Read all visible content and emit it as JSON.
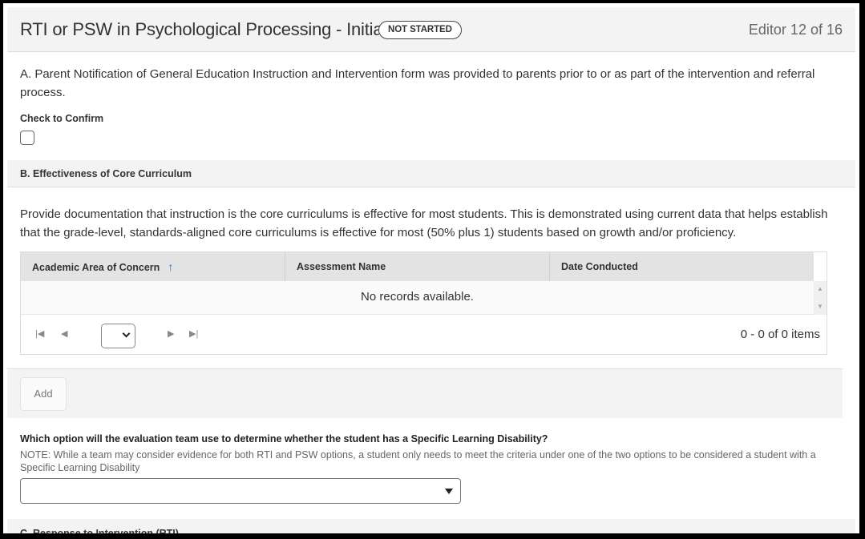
{
  "editor": {
    "title": "RTI or PSW in Psychological Processing - Initial",
    "status": "NOT STARTED",
    "counter": "Editor 12 of 16"
  },
  "section_a": {
    "text": "A. Parent Notification of General Education Instruction and Intervention form was provided to parents prior to or as part of the intervention and referral process.",
    "checkbox_label": "Check to Confirm",
    "checked": false
  },
  "section_b": {
    "title": "B. Effectiveness of Core Curriculum",
    "text": "Provide documentation that instruction is the core curriculums is effective for most students. This is demonstrated using current data that helps establish that the grade-level, standards-aligned core curriculums is effective for most (50% plus 1) students based on growth and/or proficiency.",
    "grid": {
      "columns": [
        {
          "label": "Academic Area of Concern",
          "sort": "ascending",
          "sort_icon": "arrow-up-icon"
        },
        {
          "label": "Assessment Name"
        },
        {
          "label": "Date Conducted"
        }
      ],
      "rows": [],
      "empty_message": "No records available.",
      "pager": {
        "first_icon": "first-page-icon",
        "prev_icon": "prev-page-icon",
        "next_icon": "next-page-icon",
        "last_icon": "last-page-icon",
        "page_size_value": "",
        "info": "0 - 0 of 0 items"
      }
    },
    "add_label": "Add"
  },
  "sld_question": {
    "label": "Which option will the evaluation team use to determine whether the student has a Specific Learning Disability?",
    "note": "NOTE: While a team may consider evidence for both RTI and PSW options, a student only needs to meet the criteria under one of the two options to be considered a student with a Specific Learning Disability",
    "selected_value": ""
  },
  "section_c": {
    "title": "C. Response to Intervention (RTI)"
  }
}
